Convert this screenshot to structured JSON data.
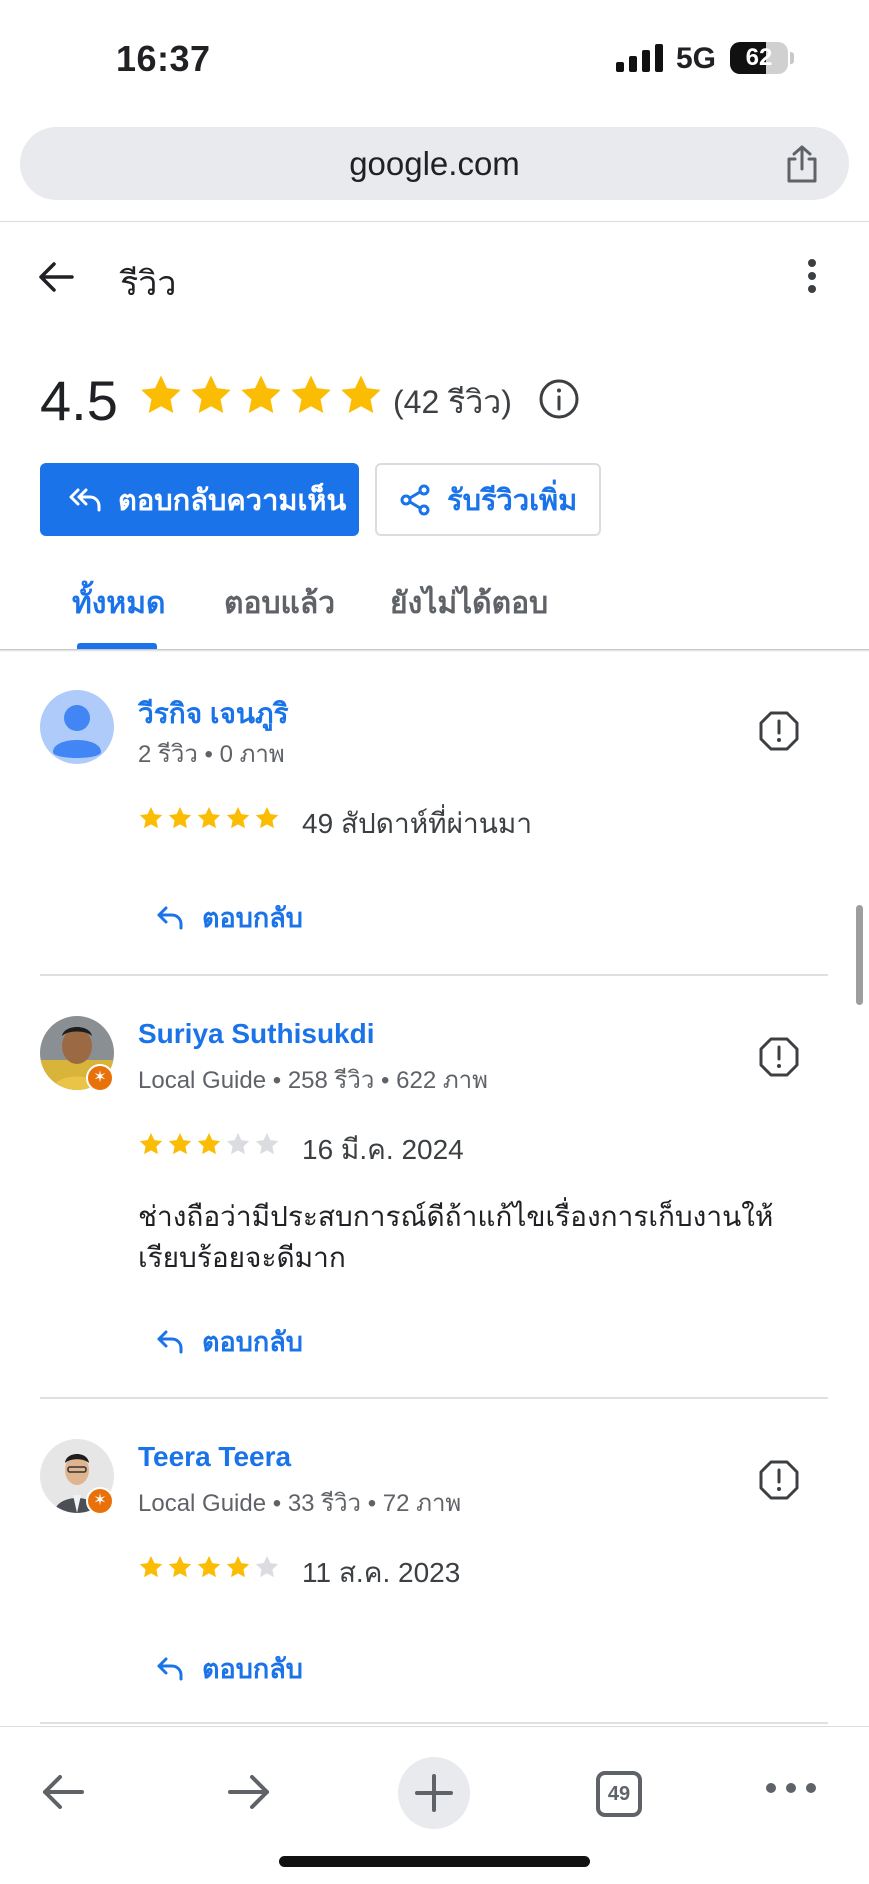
{
  "status_bar": {
    "time": "16:37",
    "network": "5G",
    "battery": "62",
    "battery_level": 0.62
  },
  "browser": {
    "url": "google.com"
  },
  "header": {
    "title": "รีวิว"
  },
  "summary": {
    "rating": "4.5",
    "rating_stars": 5,
    "review_count": "(42 รีวิว)",
    "reply_button": "ตอบกลับความเห็น",
    "more_reviews_button": "รับรีวิวเพิ่ม"
  },
  "tabs": [
    {
      "label": "ทั้งหมด",
      "active": true
    },
    {
      "label": "ตอบแล้ว",
      "active": false
    },
    {
      "label": "ยังไม่ได้ตอบ",
      "active": false
    }
  ],
  "reviews": [
    {
      "name": "วีรกิจ เจนภูริ",
      "meta": "2 รีวิว • 0 ภาพ",
      "rating": 5,
      "date": "49 สัปดาห์ที่ผ่านมา",
      "text": "",
      "reply_label": "ตอบกลับ"
    },
    {
      "name": "Suriya Suthisukdi",
      "meta": "Local Guide • 258 รีวิว • 622 ภาพ",
      "rating": 3,
      "date": "16 มี.ค. 2024",
      "text": "ช่างถือว่ามีประสบการณ์ดีถ้าแก้ไขเรื่องการเก็บงานให้เรียบร้อยจะดีมาก",
      "reply_label": "ตอบกลับ"
    },
    {
      "name": "Teera Teera",
      "meta": "Local Guide • 33 รีวิว • 72 ภาพ",
      "rating": 4,
      "date": "11 ส.ค. 2023",
      "text": "",
      "reply_label": "ตอบกลับ"
    }
  ],
  "toolbar": {
    "tab_count": "49"
  },
  "colors": {
    "accent": "#1a73e8",
    "star": "#fbbc04",
    "star_empty": "#dadce0",
    "badge": "#e8710a"
  },
  "icons": [
    "share-icon",
    "back-arrow-icon",
    "more-vert-icon",
    "info-icon",
    "reply-all-icon",
    "share-nodes-icon",
    "report-icon",
    "reply-icon",
    "person-icon",
    "local-guide-star-icon",
    "forward-arrow-icon",
    "plus-icon",
    "tabs-icon",
    "more-horiz-icon"
  ]
}
